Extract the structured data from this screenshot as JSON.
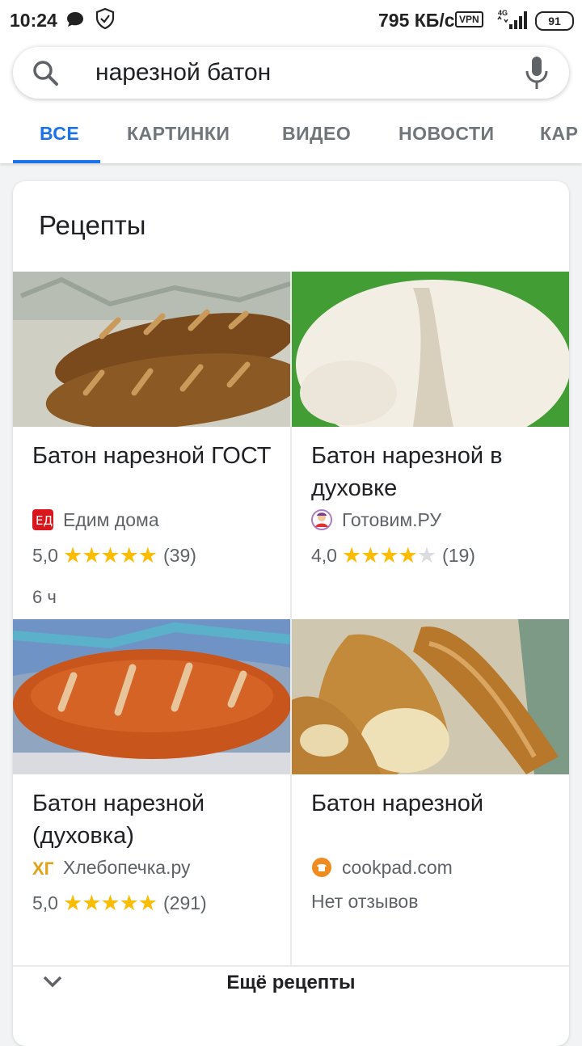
{
  "status_bar": {
    "time": "10:24",
    "speed": "795 КБ/с",
    "vpn": "VPN",
    "network": "4G",
    "battery": "91"
  },
  "search": {
    "query": "нарезной батон"
  },
  "tabs": [
    {
      "label": "ВСЕ",
      "active": true
    },
    {
      "label": "КАРТИНКИ",
      "active": false
    },
    {
      "label": "ВИДЕО",
      "active": false
    },
    {
      "label": "НОВОСТИ",
      "active": false
    },
    {
      "label": "КАР",
      "active": false
    }
  ],
  "recipes": {
    "title": "Рецепты",
    "items": [
      {
        "title": "Батон нарезной ГОСТ",
        "source": "Едим дома",
        "source_icon": "edim-doma-logo",
        "rating": "5,0",
        "stars": 5,
        "reviews": "(39)",
        "time": "6 ч"
      },
      {
        "title": "Батон нарезной в духовке",
        "source": "Готовим.РУ",
        "source_icon": "gotovim-logo",
        "rating": "4,0",
        "stars": 4,
        "reviews": "(19)"
      },
      {
        "title": "Батон нарезной (духовка)",
        "source": "Хлебопечка.ру",
        "source_icon": "hlebopechka-logo",
        "rating": "5,0",
        "stars": 5,
        "reviews": "(291)"
      },
      {
        "title": "Батон нарезной",
        "source": "cookpad.com",
        "source_icon": "cookpad-logo",
        "no_reviews": "Нет отзывов"
      }
    ],
    "more_label": "Ещё рецепты"
  },
  "colors": {
    "accent": "#1a73e8",
    "star": "#fbbc04"
  }
}
